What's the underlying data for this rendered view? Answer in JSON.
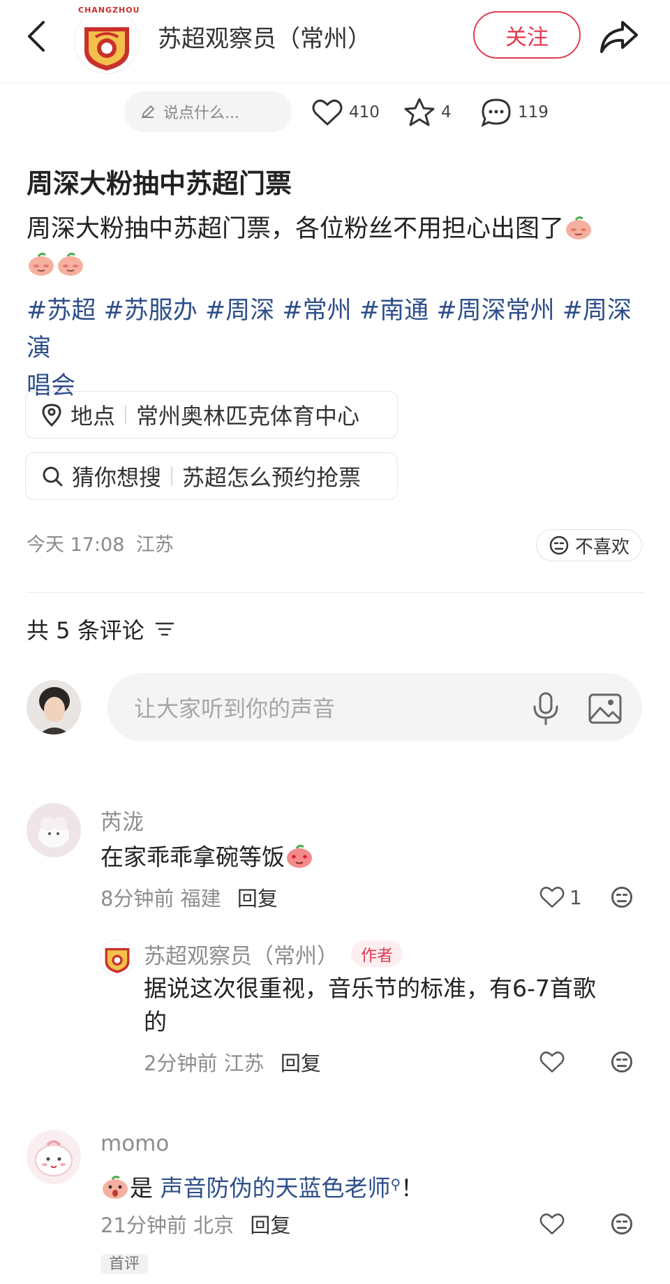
{
  "header": {
    "author_name": "苏超观察员（常州）",
    "logo_text": "CHANGZHOU",
    "follow_label": "关注"
  },
  "action_bar": {
    "say_placeholder": "说点什么...",
    "likes": "410",
    "stars": "4",
    "comments": "119"
  },
  "post": {
    "title": "周深大粉抽中苏超门票",
    "body": "周深大粉抽中苏超门票，各位粉丝不用担心出图了",
    "tags_line1": "#苏超 #苏服办 #周深 #常州 #南通 #周深常州 #周深演",
    "tags_line2": "唱会",
    "location_label": "地点",
    "location_value": "常州奥林匹克体育中心",
    "search_label": "猜你想搜",
    "search_value": "苏超怎么预约抢票",
    "time": "今天 17:08",
    "region": "江苏",
    "dislike_label": "不喜欢"
  },
  "comments_section": {
    "count_label": "共 5 条评论",
    "input_placeholder": "让大家听到你的声音"
  },
  "comments": [
    {
      "user": "芮泷",
      "text": "在家乖乖拿碗等饭",
      "time": "8分钟前",
      "region": "福建",
      "reply_label": "回复",
      "likes": "1"
    },
    {
      "user": "苏超观察员（常州）",
      "badge": "作者",
      "text_line1": "据说这次很重视，音乐节的标准，有6-7首歌",
      "text_line2": "的",
      "time": "2分钟前",
      "region": "江苏",
      "reply_label": "回复"
    },
    {
      "user": "momo",
      "text_prefix": "是",
      "text_link": "声音防伪的天蓝色老师",
      "text_suffix": "！",
      "time": "21分钟前",
      "region": "北京",
      "reply_label": "回复",
      "tag": "首评"
    }
  ],
  "colors": {
    "accent": "#e03b51",
    "link": "#2e4f8a",
    "muted": "#8d8d8d"
  }
}
